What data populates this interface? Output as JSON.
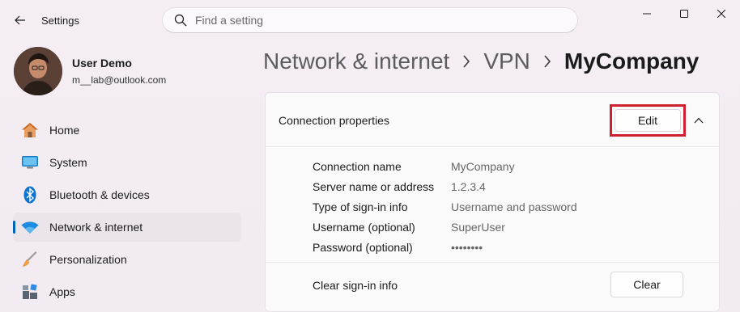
{
  "app": {
    "title": "Settings"
  },
  "search": {
    "placeholder": "Find a setting",
    "value": ""
  },
  "profile": {
    "name": "User Demo",
    "email": "m__lab@outlook.com"
  },
  "sidebar": {
    "items": [
      {
        "label": "Home",
        "icon": "home-icon",
        "active": false
      },
      {
        "label": "System",
        "icon": "system-icon",
        "active": false
      },
      {
        "label": "Bluetooth & devices",
        "icon": "bluetooth-icon",
        "active": false
      },
      {
        "label": "Network & internet",
        "icon": "wifi-icon",
        "active": true
      },
      {
        "label": "Personalization",
        "icon": "brush-icon",
        "active": false
      },
      {
        "label": "Apps",
        "icon": "apps-icon",
        "active": false
      }
    ]
  },
  "breadcrumb": {
    "items": [
      "Network & internet",
      "VPN",
      "MyCompany"
    ]
  },
  "card": {
    "title": "Connection properties",
    "edit_label": "Edit",
    "properties": [
      {
        "label": "Connection name",
        "value": "MyCompany"
      },
      {
        "label": "Server name or address",
        "value": "1.2.3.4"
      },
      {
        "label": "Type of sign-in info",
        "value": "Username and password"
      },
      {
        "label": "Username (optional)",
        "value": "SuperUser"
      },
      {
        "label": "Password (optional)",
        "value": "••••••••"
      }
    ],
    "clear_label": "Clear sign-in info",
    "clear_button": "Clear"
  },
  "colors": {
    "accent": "#0063b1",
    "highlight": "#d0202f"
  }
}
